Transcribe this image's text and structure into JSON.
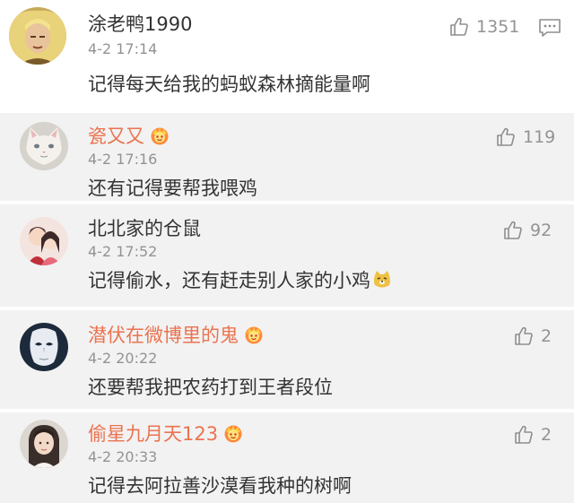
{
  "main": {
    "username": "涂老鸭1990",
    "time": "4-2 17:14",
    "text": "记得每天给我的蚂蚁森林摘能量啊",
    "likes": "1351",
    "avatar_icon": "yellow-haired-figure-avatar",
    "reply_icon": "comment-reply-icon"
  },
  "replies": [
    {
      "username": "瓷又又",
      "vip": true,
      "time": "4-2 17:16",
      "text": "还有记得要帮我喂鸡",
      "likes": "119",
      "avatar_icon": "cat-avatar"
    },
    {
      "username": "北北家的仓鼠",
      "vip": false,
      "time": "4-2 17:52",
      "text": "记得偷水，还有赶走别人家的小鸡",
      "emoji": "doge-emoji",
      "likes": "92",
      "avatar_icon": "anime-couple-avatar"
    },
    {
      "username": "潜伏在微博里的鬼",
      "vip": true,
      "time": "4-2 20:22",
      "text": "还要帮我把农药打到王者段位",
      "likes": "2",
      "avatar_icon": "mask-avatar"
    },
    {
      "username": "偷星九月天123",
      "vip": true,
      "time": "4-2 20:33",
      "text": "记得去阿拉善沙漠看我种的树啊",
      "likes": "2",
      "avatar_icon": "girl-photo-avatar"
    }
  ],
  "colors": {
    "vip_name": "#eb7350",
    "normal_name": "#333333",
    "meta_gray": "#939393",
    "reply_bg": "#f2f2f2",
    "crown_orange": "#f5a623"
  }
}
